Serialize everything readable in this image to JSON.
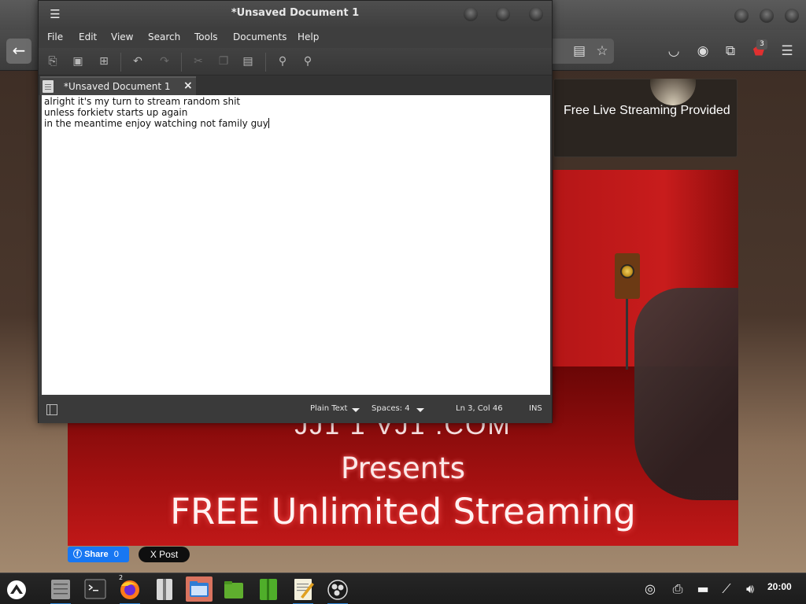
{
  "browser": {
    "back_icon": "arrow-left",
    "toolbar_icons": [
      "reader-view-icon",
      "bookmark-star-icon",
      "pocket-icon",
      "account-icon",
      "extensions-icon",
      "ublock-icon",
      "hamburger-menu-icon"
    ],
    "ublock_badge": "3",
    "site": {
      "tagline": "Free Live Streaming Provided",
      "brand_fragment": "JJ1 1 VJ1 .COM",
      "presents": "Presents",
      "headline": "FREE Unlimited Streaming"
    },
    "share": {
      "fb_label": "Share",
      "fb_count": "0",
      "x_label": "X Post"
    }
  },
  "editor": {
    "title": "*Unsaved Document 1",
    "menu": [
      "File",
      "Edit",
      "View",
      "Search",
      "Tools",
      "Documents",
      "Help"
    ],
    "toolbar": [
      "new-document-icon",
      "open-icon",
      "save-icon",
      "undo-icon",
      "redo-icon",
      "cut-icon",
      "copy-icon",
      "paste-icon",
      "find-icon",
      "find-replace-icon"
    ],
    "tab": {
      "label": "*Unsaved Document 1",
      "close": "×"
    },
    "lines": [
      "alright it's my turn to stream random shit",
      "unless forkietv starts up again",
      "in the meantime enjoy watching not family guy"
    ],
    "status": {
      "language": "Plain Text",
      "spaces": "Spaces: 4",
      "position": "Ln 3, Col 46",
      "mode": "INS"
    }
  },
  "taskbar": {
    "apps": [
      "start-menu-icon",
      "file-cabinet-icon",
      "terminal-icon",
      "firefox-icon",
      "archive-manager-icon",
      "file-manager-icon",
      "green-folder-icon",
      "green-notebook-icon",
      "text-editor-icon",
      "obs-studio-icon"
    ],
    "firefox_badge": "2",
    "clock": "20:00"
  },
  "colors": {
    "accent_blue": "#1877f2",
    "stream_red": "#c81c1c",
    "task_active": "#d9735f"
  }
}
